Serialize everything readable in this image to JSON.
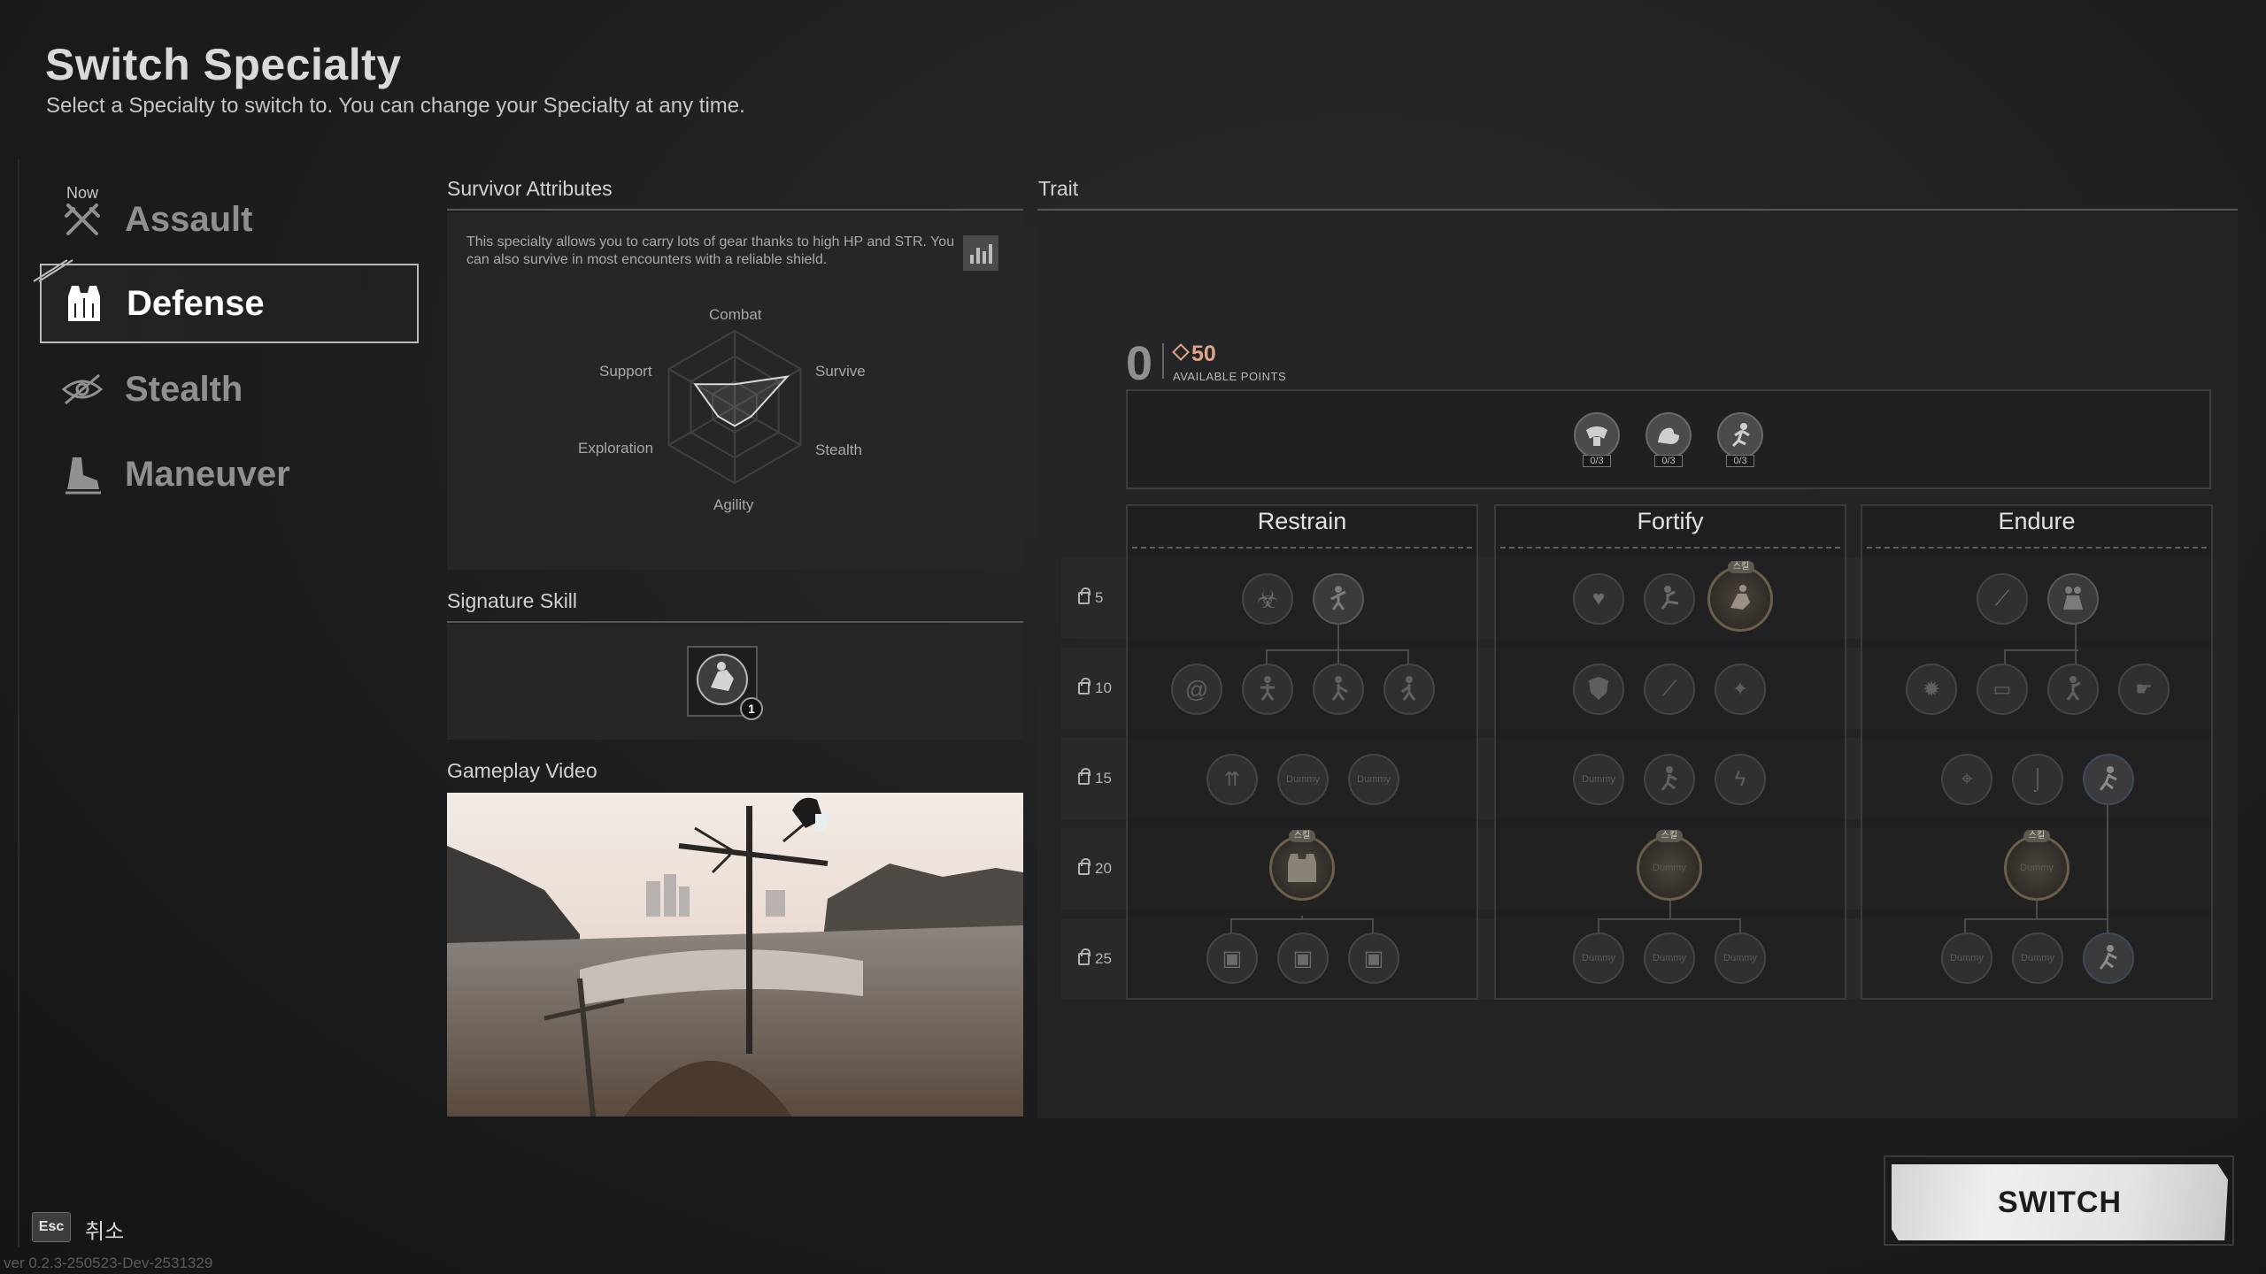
{
  "header": {
    "title": "Switch Specialty",
    "subtitle": "Select a Specialty to switch to. You can change your Specialty at any time."
  },
  "specialties": [
    {
      "label": "Assault",
      "icon": "crossed-rifles-icon",
      "tag": "Now"
    },
    {
      "label": "Defense",
      "icon": "armor-vest-icon",
      "active": true
    },
    {
      "label": "Stealth",
      "icon": "crossed-eye-icon"
    },
    {
      "label": "Maneuver",
      "icon": "running-boot-icon"
    }
  ],
  "attributes": {
    "heading": "Survivor Attributes",
    "description": "This specialty allows you to carry lots of gear thanks to high HP and STR. You can also survive in most encounters with a reliable shield.",
    "stat_icon": "bar-chart-icon",
    "radar_labels": [
      "Combat",
      "Survive",
      "Stealth",
      "Agility",
      "Exploration",
      "Support"
    ],
    "radar_values": [
      0.3,
      0.8,
      0.25,
      0.25,
      0.25,
      0.6
    ]
  },
  "signature": {
    "heading": "Signature Skill",
    "icon": "shield-bash-icon",
    "badge": "1"
  },
  "video": {
    "heading": "Gameplay Video"
  },
  "trait": {
    "heading": "Trait",
    "points": "0",
    "available": "50",
    "available_label": "AVAILABLE POINTS",
    "core_counts": [
      "0/3",
      "0/3",
      "0/3"
    ],
    "node_tag": "스킬",
    "node_text": "Dummy",
    "columns": [
      "Restrain",
      "Fortify",
      "Endure"
    ],
    "levels": [
      "5",
      "10",
      "15",
      "20",
      "25"
    ]
  },
  "footer": {
    "switch_label": "SWITCH",
    "esc_key": "Esc",
    "cancel_label": "취소",
    "version": "ver 0.2.3-250523-Dev-2531329"
  },
  "colors": {
    "accent_points": "#e2a48a",
    "background": "#1c1d1e",
    "panel": "#252627"
  }
}
